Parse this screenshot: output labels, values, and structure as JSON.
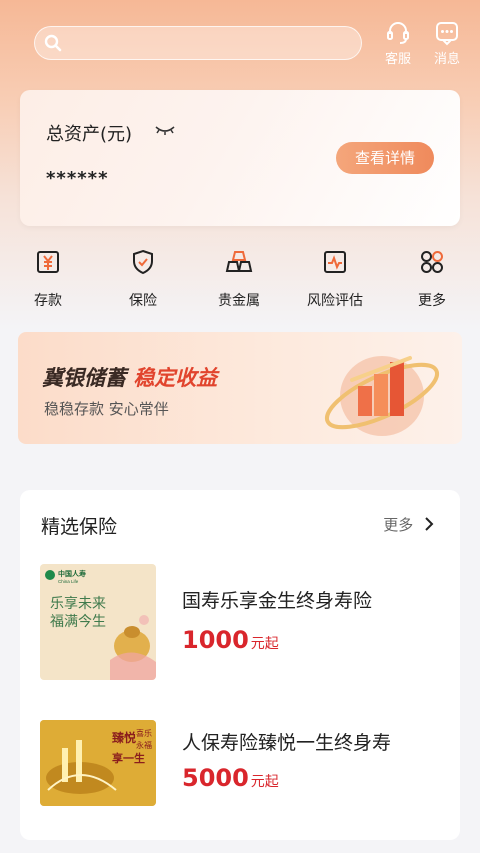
{
  "header": {
    "search_placeholder": "",
    "service_label": "客服",
    "message_label": "消息"
  },
  "assets": {
    "title": "总资产(元)",
    "value": "******",
    "detail_button": "查看详情"
  },
  "quick_nav": [
    {
      "label": "存款",
      "icon": "deposit-icon"
    },
    {
      "label": "保险",
      "icon": "insurance-shield-icon"
    },
    {
      "label": "贵金属",
      "icon": "gold-bars-icon"
    },
    {
      "label": "风险评估",
      "icon": "risk-chart-icon"
    },
    {
      "label": "更多",
      "icon": "more-grid-icon"
    }
  ],
  "banner": {
    "title_main": "冀银储蓄",
    "title_highlight": "稳定收益",
    "subtitle": "稳稳存款 安心常伴"
  },
  "insurance": {
    "heading": "精选保险",
    "more_label": "更多",
    "products": [
      {
        "name": "国寿乐享金生终身寿险",
        "price": "1000",
        "unit": "元起",
        "thumb_logo": "中国人寿",
        "thumb_logo_en": "China Life",
        "thumb_line1": "乐享未来",
        "thumb_line2": "福满今生"
      },
      {
        "name": "人保寿险臻悦一生终身寿",
        "price": "5000",
        "unit": "元起",
        "thumb_line1": "臻悦",
        "thumb_line2": "享一生",
        "thumb_line3": "喜乐",
        "thumb_line4": "永福"
      }
    ]
  },
  "colors": {
    "accent": "#ef8a5c",
    "price": "#d9262c",
    "banner_highlight": "#e1442d"
  }
}
